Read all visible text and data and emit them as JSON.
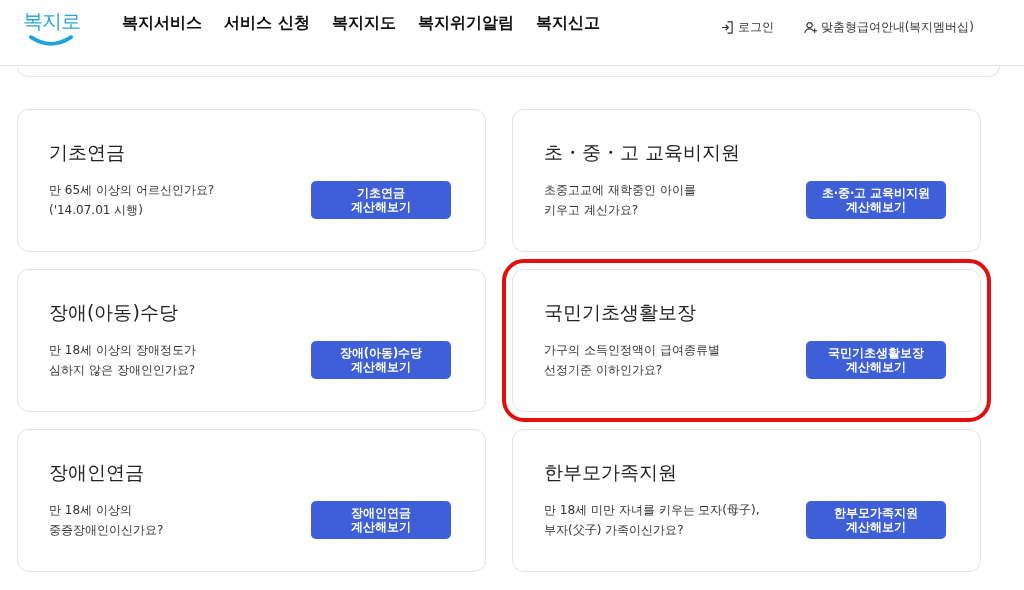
{
  "header": {
    "logo": "복지로",
    "nav": [
      "복지서비스",
      "서비스 신청",
      "복지지도",
      "복지위기알림",
      "복지신고"
    ],
    "utility": [
      {
        "kind": "login",
        "label": "로그인"
      },
      {
        "kind": "member",
        "label": "맞춤형급여안내(복지멤버십)"
      }
    ]
  },
  "cards": [
    {
      "title": "기초연금",
      "description": [
        "만 65세 이상의 어르신인가요?",
        "('14.07.01 시행)"
      ],
      "button": [
        "기초연금",
        "계산해보기"
      ],
      "highlighted": false
    },
    {
      "title": "초・중・고 교육비지원",
      "description": [
        "초중고교에 재학중인 아이를",
        "키우고 계신가요?"
      ],
      "button": [
        "초·중·고 교육비지원",
        "계산해보기"
      ],
      "highlighted": false
    },
    {
      "title": "장애(아동)수당",
      "description": [
        "만 18세 이상의 장애정도가",
        "심하지 않은 장애인인가요?"
      ],
      "button": [
        "장애(아동)수당",
        "계산해보기"
      ],
      "highlighted": false
    },
    {
      "title": "국민기초생활보장",
      "description": [
        "가구의 소득인정액이 급여종류별",
        "선정기준 이하인가요?"
      ],
      "button": [
        "국민기초생활보장",
        "계산해보기"
      ],
      "highlighted": true
    },
    {
      "title": "장애인연금",
      "description": [
        "만 18세 이상의",
        "중증장애인이신가요?"
      ],
      "button": [
        "장애인연금",
        "계산해보기"
      ],
      "highlighted": false
    },
    {
      "title": "한부모가족지원",
      "description": [
        "만 18세 미만 자녀를 키우는 모자(母子),",
        "부자(父子) 가족이신가요?"
      ],
      "button": [
        "한부모가족지원",
        "계산해보기"
      ],
      "highlighted": false
    }
  ]
}
